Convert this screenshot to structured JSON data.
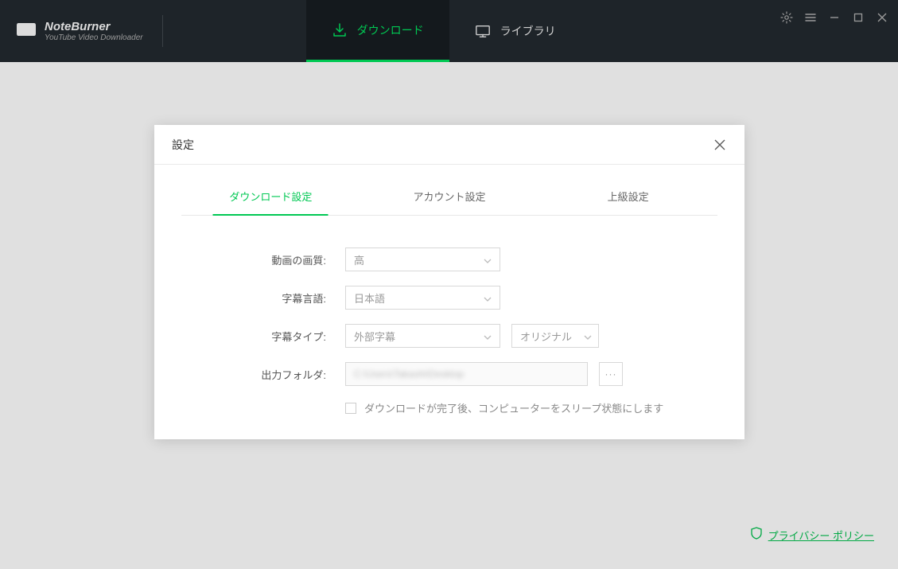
{
  "app": {
    "title": "NoteBurner",
    "subtitle": "YouTube Video Downloader"
  },
  "nav": {
    "download": "ダウンロード",
    "library": "ライブラリ"
  },
  "dialog": {
    "title": "設定",
    "tabs": {
      "download": "ダウンロード設定",
      "account": "アカウント設定",
      "advanced": "上級設定"
    },
    "labels": {
      "quality": "動画の画質:",
      "subtitle_lang": "字幕言語:",
      "subtitle_type": "字幕タイプ:",
      "output_folder": "出力フォルダ:"
    },
    "values": {
      "quality": "高",
      "subtitle_lang": "日本語",
      "subtitle_type": "外部字幕",
      "subtitle_variant": "オリジナル",
      "output_folder": "C:\\Users\\Takashi\\Desktop",
      "more": "···"
    },
    "checkbox_label": "ダウンロードが完了後、コンピューターをスリープ状態にします"
  },
  "footer": {
    "privacy": "プライバシー ポリシー"
  }
}
